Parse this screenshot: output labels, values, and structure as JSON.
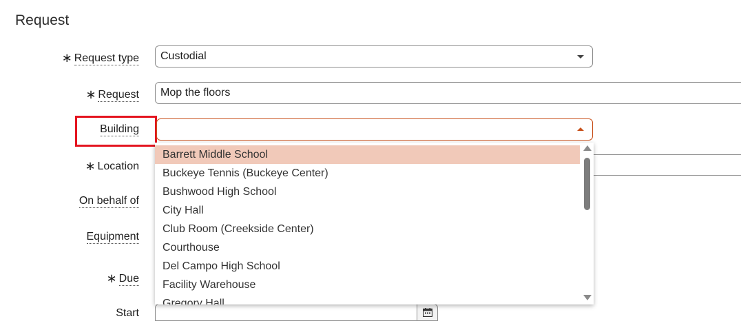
{
  "section": {
    "title": "Request"
  },
  "fields": {
    "request_type": {
      "label": "Request type",
      "required": "∗",
      "value": "Custodial"
    },
    "request": {
      "label": "Request",
      "required": "∗",
      "value": "Mop the floors"
    },
    "building": {
      "label": "Building",
      "value": ""
    },
    "location": {
      "label": "Location",
      "required": "∗"
    },
    "on_behalf_of": {
      "label": "On behalf of"
    },
    "equipment": {
      "label": "Equipment"
    },
    "due": {
      "label": "Due",
      "required": "∗"
    },
    "start": {
      "label": "Start"
    }
  },
  "building_dropdown": {
    "options": [
      "Barrett Middle School",
      "Buckeye Tennis (Buckeye Center)",
      "Bushwood High School",
      "City Hall",
      "Club Room (Creekside Center)",
      "Courthouse",
      "Del Campo High School",
      "Facility Warehouse",
      "Gregory Hall"
    ],
    "highlighted": "Barrett Middle School"
  },
  "colors": {
    "focus_border": "#c8511b",
    "highlight_option": "#f1c9b9",
    "annotation_box": "#e4141f"
  },
  "icons": {
    "dropdown": "caret-down-icon",
    "dropdown_open": "caret-up-icon",
    "calendar": "calendar-icon"
  }
}
